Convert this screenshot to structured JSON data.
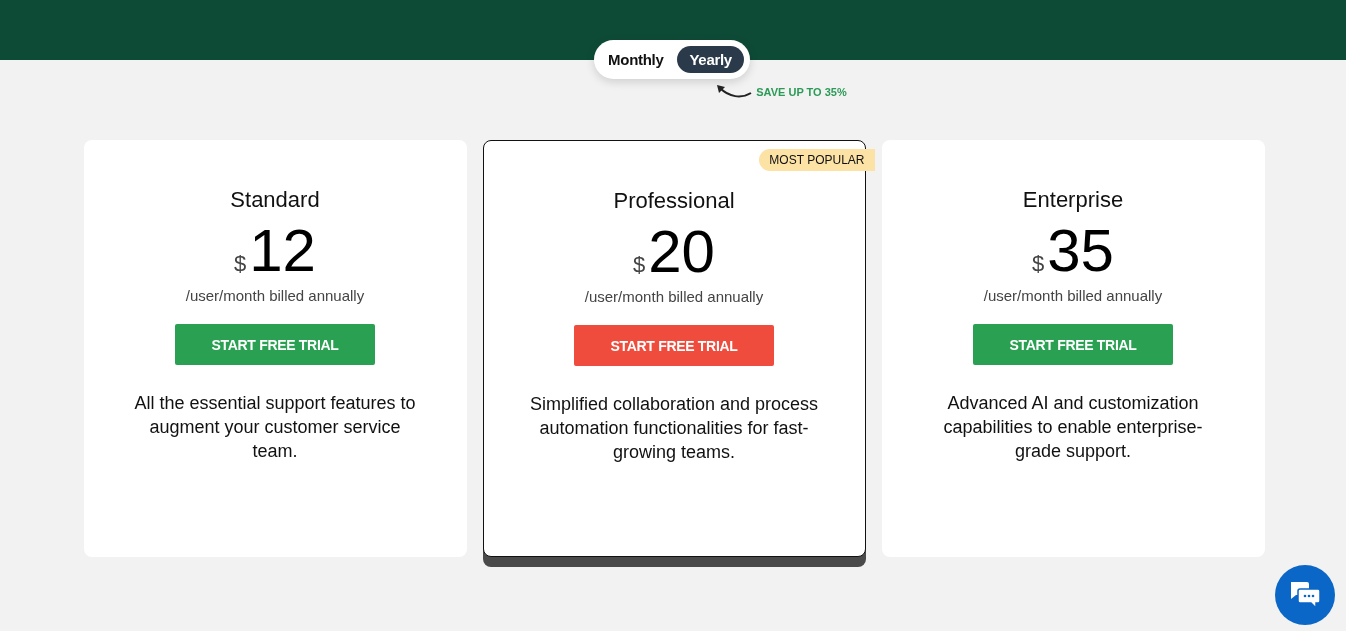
{
  "billing_toggle": [
    {
      "label": "Monthly",
      "selected": false
    },
    {
      "label": "Yearly",
      "selected": true
    }
  ],
  "savings_note": "SAVE UP TO 35%",
  "plans": [
    {
      "name": "Standard",
      "currency": "$",
      "price": "12",
      "period": "/user/month billed annually",
      "button": "START FREE TRIAL",
      "description": "All the essential support features to augment your customer service team.",
      "highlighted": false
    },
    {
      "name": "Professional",
      "currency": "$",
      "price": "20",
      "period": "/user/month billed annually",
      "button": "START FREE TRIAL",
      "description": "Simplified collaboration and process automation functionalities for fast-growing teams.",
      "highlighted": true,
      "badge": "MOST POPULAR"
    },
    {
      "name": "Enterprise",
      "currency": "$",
      "price": "35",
      "period": "/user/month billed annually",
      "button": "START FREE TRIAL",
      "description": "Advanced AI and customization capabilities to enable enterprise-grade support.",
      "highlighted": false
    }
  ]
}
